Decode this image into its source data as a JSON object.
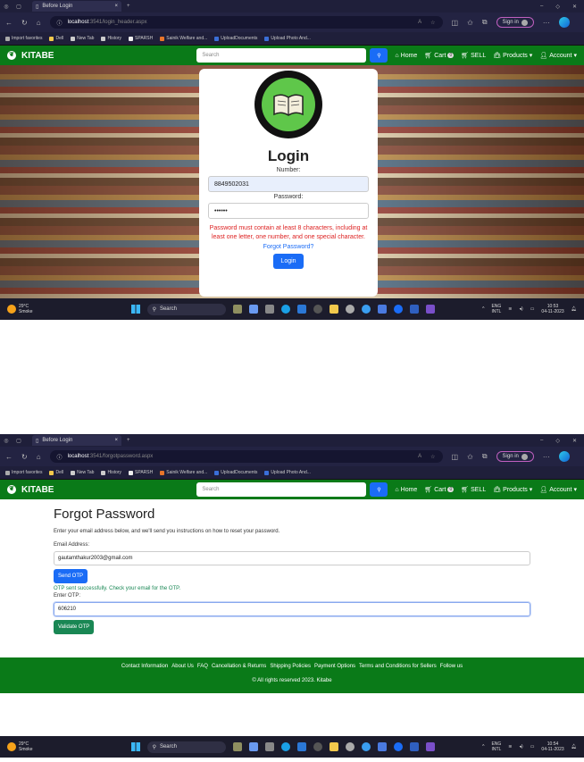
{
  "browser": {
    "tab_title": "Before Login",
    "favorites": [
      "Import favorites",
      "Dell",
      "New Tab",
      "History",
      "SPARSH",
      "Sainik Welfare and...",
      "UploadDocuments",
      "Upload Photo And..."
    ],
    "signin": "Sign in"
  },
  "shot1": {
    "url_host": "localhost",
    "url_path": ":3541/login_header.aspx"
  },
  "shot2": {
    "url_host": "localhost",
    "url_path": ":3541/forgotpassword.aspx"
  },
  "navbar": {
    "brand": "KITABE",
    "search_placeholder": "Search",
    "home": "Home",
    "cart": "Cart",
    "cart_count": "0",
    "sell": "SELL",
    "products": "Products",
    "account": "Account"
  },
  "login": {
    "title": "Login",
    "number_label": "Number:",
    "number_value": "8849502031",
    "password_label": "Password:",
    "password_value": "••••••",
    "error": "Password must contain at least 8 characters, including at least one letter, one number, and one special character.",
    "forgot_link": "Forgot Password?",
    "login_button": "Login"
  },
  "forgot": {
    "title": "Forgot Password",
    "description": "Enter your email address below, and we'll send you instructions on how to reset your password.",
    "email_label": "Email Address:",
    "email_value": "gautamthakur2003@gmail.com",
    "send_otp": "Send OTP",
    "success": "OTP sent successfully. Check your email for the OTP.",
    "otp_label": "Enter OTP:",
    "otp_value": "606210",
    "validate_otp": "Validate OTP"
  },
  "footer": {
    "links": [
      "Contact Information",
      "About Us",
      "FAQ",
      "Cancellation & Returns",
      "Shipping Policies",
      "Payment Options",
      "Terms and Conditions for Sellers",
      "Follow us"
    ],
    "copyright": "© All rights reserved 2023. Kitabe"
  },
  "taskbar": {
    "temp": "29°C",
    "weather": "Smoke",
    "search": "Search",
    "lang1": "ENG",
    "lang2": "INTL",
    "shot1_time": "10:53",
    "shot2_time": "10:54",
    "date": "04-11-2023"
  }
}
